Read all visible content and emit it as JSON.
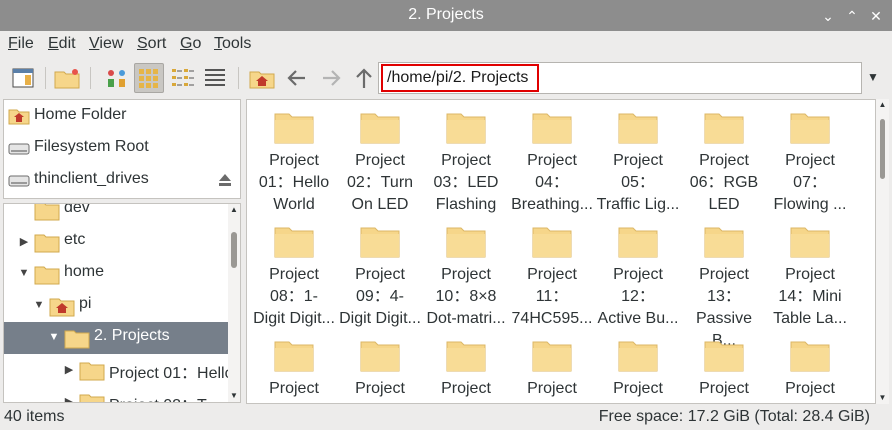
{
  "window": {
    "title": "2. Projects"
  },
  "menu": [
    {
      "label": "File",
      "key": "F",
      "rest": "ile"
    },
    {
      "label": "Edit",
      "key": "E",
      "rest": "dit"
    },
    {
      "label": "View",
      "key": "V",
      "rest": "iew"
    },
    {
      "label": "Sort",
      "key": "S",
      "rest": "ort"
    },
    {
      "label": "Go",
      "key": "G",
      "rest": "o"
    },
    {
      "label": "Tools",
      "key": "T",
      "rest": "ools"
    }
  ],
  "toolbar": {
    "icons": [
      "new-window-icon",
      "new-folder-icon",
      "icon-view-icon",
      "thumbnail-view-icon",
      "compact-view-icon",
      "detailed-list-view-icon",
      "home-icon",
      "back-arrow-icon",
      "forward-arrow-icon",
      "up-arrow-icon"
    ],
    "path": "/home/pi/2. Projects"
  },
  "places": [
    {
      "label": "Home Folder",
      "icon": "home-folder-icon"
    },
    {
      "label": "Filesystem Root",
      "icon": "drive-icon"
    },
    {
      "label": "thinclient_drives",
      "icon": "drive-icon"
    }
  ],
  "tree": [
    {
      "label": "dev",
      "depth": 1,
      "arrow": "",
      "selected": false
    },
    {
      "label": "etc",
      "depth": 1,
      "arrow": "▶",
      "selected": false
    },
    {
      "label": "home",
      "depth": 1,
      "arrow": "▼",
      "selected": false
    },
    {
      "label": "pi",
      "depth": 2,
      "arrow": "▼",
      "selected": false,
      "home": true
    },
    {
      "label": "2. Projects",
      "depth": 3,
      "arrow": "▼",
      "selected": true
    },
    {
      "label": "Project 01：Hello",
      "depth": 4,
      "arrow": "▶",
      "selected": false
    },
    {
      "label": "Project 02：T",
      "depth": 4,
      "arrow": "▶",
      "selected": false
    }
  ],
  "files": [
    {
      "lines": [
        "Project",
        "01：Hello",
        "World"
      ]
    },
    {
      "lines": [
        "Project",
        "02：Turn",
        "On LED"
      ]
    },
    {
      "lines": [
        "Project",
        "03：LED",
        "Flashing"
      ]
    },
    {
      "lines": [
        "Project",
        "04：",
        "Breathing..."
      ]
    },
    {
      "lines": [
        "Project",
        "05：",
        "Traffic Lig..."
      ]
    },
    {
      "lines": [
        "Project",
        "06：RGB",
        "LED"
      ]
    },
    {
      "lines": [
        "Project",
        "07：",
        "Flowing ..."
      ]
    },
    {
      "lines": [
        "Project",
        "08：1-",
        "Digit Digit..."
      ]
    },
    {
      "lines": [
        "Project",
        "09：4-",
        "Digit Digit..."
      ]
    },
    {
      "lines": [
        "Project",
        "10：8×8",
        "Dot-matri..."
      ]
    },
    {
      "lines": [
        "Project",
        "11：",
        "74HC595..."
      ]
    },
    {
      "lines": [
        "Project",
        "12：",
        "Active Bu..."
      ]
    },
    {
      "lines": [
        "Project",
        "13：",
        "Passive B..."
      ]
    },
    {
      "lines": [
        "Project",
        "14：Mini",
        "Table La..."
      ]
    },
    {
      "lines": [
        "Project",
        "",
        ""
      ]
    },
    {
      "lines": [
        "Project",
        "",
        ""
      ]
    },
    {
      "lines": [
        "Project",
        "",
        ""
      ]
    },
    {
      "lines": [
        "Project",
        "",
        ""
      ]
    },
    {
      "lines": [
        "Project",
        "",
        ""
      ]
    },
    {
      "lines": [
        "Project",
        "",
        ""
      ]
    },
    {
      "lines": [
        "Project",
        "",
        ""
      ]
    }
  ],
  "status": {
    "count": "40 items",
    "free": "Free space: 17.2 GiB (Total: 28.4 GiB)"
  },
  "colors": {
    "folder": "#f6d68a",
    "selection": "#767f8a",
    "highlight": "#e00000"
  }
}
